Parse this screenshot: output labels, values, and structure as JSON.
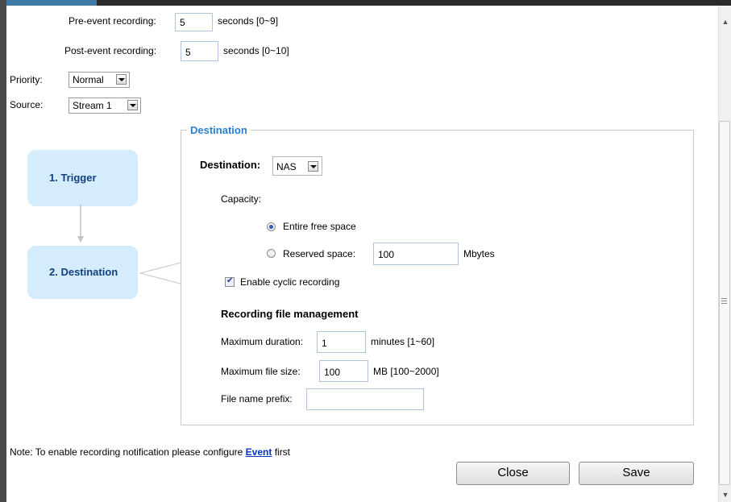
{
  "recording": {
    "pre_event_label": "Pre-event recording:",
    "pre_event_value": "5",
    "pre_event_hint": "seconds [0~9]",
    "post_event_label": "Post-event recording:",
    "post_event_value": "5",
    "post_event_hint": "seconds [0~10]",
    "priority_label": "Priority:",
    "priority_value": "Normal",
    "source_label": "Source:",
    "source_value": "Stream 1"
  },
  "steps": [
    {
      "label": "1. Trigger"
    },
    {
      "label": "2. Destination"
    }
  ],
  "destination": {
    "section_title": "Destination",
    "label": "Destination:",
    "value": "NAS",
    "capacity_label": "Capacity:",
    "entire_free_space": "Entire free space",
    "reserved_space_label": "Reserved space:",
    "reserved_space_value": "100",
    "reserved_space_unit": "Mbytes",
    "cyclic_label": "Enable cyclic recording",
    "file_mgmt_title": "Recording file management",
    "max_duration_label": "Maximum duration:",
    "max_duration_value": "1",
    "max_duration_hint": "minutes [1~60]",
    "max_file_size_label": "Maximum file size:",
    "max_file_size_value": "100",
    "max_file_size_hint": "MB [100~2000]",
    "file_prefix_label": "File name prefix:",
    "file_prefix_value": ""
  },
  "note": {
    "prefix": "Note: To enable recording notification please configure",
    "link": "Event",
    "suffix": "first"
  },
  "buttons": {
    "close": "Close",
    "save": "Save"
  },
  "colors": {
    "accent_blue": "#2a7fcf",
    "step_box": "#d4ecfb"
  }
}
